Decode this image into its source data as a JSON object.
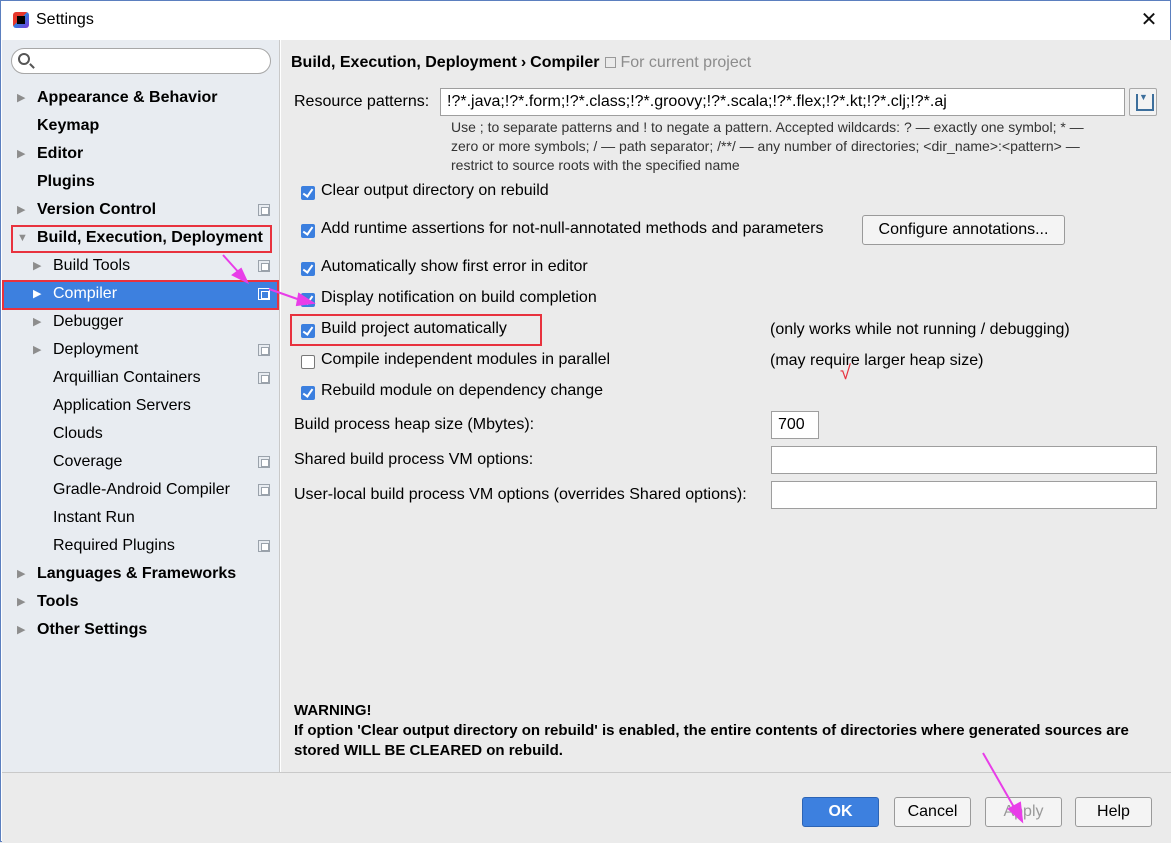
{
  "window": {
    "title": "Settings",
    "close_glyph": "✕"
  },
  "search": {
    "placeholder": ""
  },
  "tree": [
    {
      "label": "Appearance & Behavior",
      "bold": true,
      "level": 0,
      "arrow": "▶",
      "project": false
    },
    {
      "label": "Keymap",
      "bold": true,
      "level": 0,
      "arrow": "",
      "project": false
    },
    {
      "label": "Editor",
      "bold": true,
      "level": 0,
      "arrow": "▶",
      "project": false
    },
    {
      "label": "Plugins",
      "bold": true,
      "level": 0,
      "arrow": "",
      "project": false
    },
    {
      "label": "Version Control",
      "bold": true,
      "level": 0,
      "arrow": "▶",
      "project": true
    },
    {
      "label": "Build, Execution, Deployment",
      "bold": true,
      "level": 0,
      "arrow": "▼",
      "project": false
    },
    {
      "label": "Build Tools",
      "bold": false,
      "level": 1,
      "arrow": "▶",
      "project": true
    },
    {
      "label": "Compiler",
      "bold": false,
      "level": 1,
      "arrow": "▶",
      "project": true,
      "selected": true
    },
    {
      "label": "Debugger",
      "bold": false,
      "level": 1,
      "arrow": "▶",
      "project": false
    },
    {
      "label": "Deployment",
      "bold": false,
      "level": 1,
      "arrow": "▶",
      "project": true
    },
    {
      "label": "Arquillian Containers",
      "bold": false,
      "level": 1,
      "arrow": "",
      "project": true
    },
    {
      "label": "Application Servers",
      "bold": false,
      "level": 1,
      "arrow": "",
      "project": false
    },
    {
      "label": "Clouds",
      "bold": false,
      "level": 1,
      "arrow": "",
      "project": false
    },
    {
      "label": "Coverage",
      "bold": false,
      "level": 1,
      "arrow": "",
      "project": true
    },
    {
      "label": "Gradle-Android Compiler",
      "bold": false,
      "level": 1,
      "arrow": "",
      "project": true
    },
    {
      "label": "Instant Run",
      "bold": false,
      "level": 1,
      "arrow": "",
      "project": false
    },
    {
      "label": "Required Plugins",
      "bold": false,
      "level": 1,
      "arrow": "",
      "project": true
    },
    {
      "label": "Languages & Frameworks",
      "bold": true,
      "level": 0,
      "arrow": "▶",
      "project": false
    },
    {
      "label": "Tools",
      "bold": true,
      "level": 0,
      "arrow": "▶",
      "project": false
    },
    {
      "label": "Other Settings",
      "bold": true,
      "level": 0,
      "arrow": "▶",
      "project": false
    }
  ],
  "breadcrumb": {
    "parent": "Build, Execution, Deployment",
    "separator": "›",
    "current": "Compiler",
    "scope": "For current project"
  },
  "resource": {
    "label": "Resource patterns:",
    "value": "!?*.java;!?*.form;!?*.class;!?*.groovy;!?*.scala;!?*.flex;!?*.kt;!?*.clj;!?*.aj",
    "hint_line1": "Use ; to separate patterns and ! to negate a pattern. Accepted wildcards: ? — exactly one symbol; * —",
    "hint_line2": "zero or more symbols; / — path separator; /**/ — any number of directories; <dir_name>:<pattern> —",
    "hint_line3": "restrict to source roots with the specified name"
  },
  "options": {
    "clear_output": {
      "label": "Clear output directory on rebuild",
      "checked": true
    },
    "runtime_assertions": {
      "label": "Add runtime assertions for not-null-annotated methods and parameters",
      "checked": true
    },
    "configure_annotations": "Configure annotations...",
    "show_first_error": {
      "label": "Automatically show first error in editor",
      "checked": true
    },
    "build_notification": {
      "label": "Display notification on build completion",
      "checked": true
    },
    "build_auto": {
      "label": "Build project automatically",
      "checked": true,
      "note": "(only works while not running / debugging)"
    },
    "parallel": {
      "label": "Compile independent modules in parallel",
      "checked": false,
      "note": "(may require larger heap size)"
    },
    "rebuild_dep": {
      "label": "Rebuild module on dependency change",
      "checked": true
    },
    "check_mark": "√"
  },
  "heap": {
    "label": "Build process heap size (Mbytes):",
    "value": "700"
  },
  "shared_vm": {
    "label": "Shared build process VM options:",
    "value": ""
  },
  "user_vm": {
    "label": "User-local build process VM options (overrides Shared options):",
    "value": ""
  },
  "warning": {
    "title": "WARNING!",
    "text": "If option 'Clear output directory on rebuild' is enabled, the entire contents of directories where generated sources are stored WILL BE CLEARED on rebuild."
  },
  "buttons": {
    "ok": "OK",
    "cancel": "Cancel",
    "apply": "Apply",
    "help": "Help"
  },
  "colors": {
    "accent": "#3d80df",
    "annotation_red": "#e8323e",
    "annotation_magenta": "#e83de8"
  }
}
